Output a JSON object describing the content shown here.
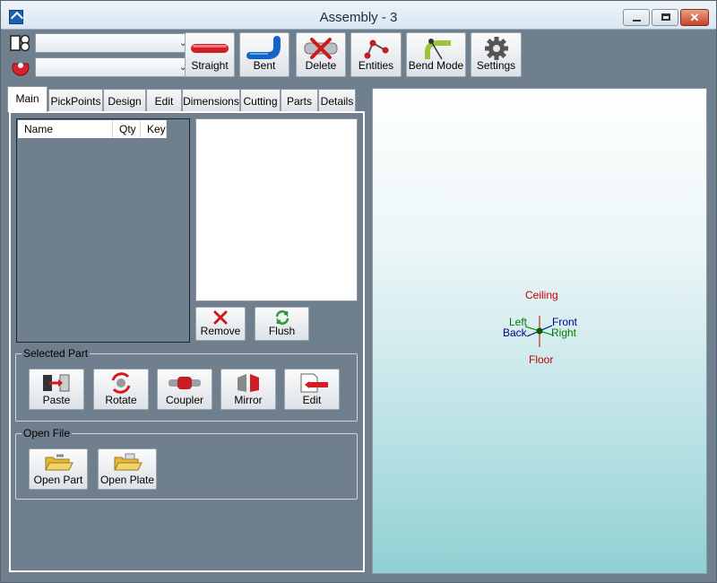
{
  "window": {
    "title": "Assembly - 3",
    "close_glyph": "✕"
  },
  "toolbar": {
    "combo_top_value": "",
    "combo_bottom_value": "",
    "buttons": [
      {
        "label": "Straight",
        "icon": "straight-pipe-icon"
      },
      {
        "label": "Bent",
        "icon": "bent-pipe-icon"
      },
      {
        "label": "Delete",
        "icon": "delete-icon"
      },
      {
        "label": "Entities",
        "icon": "entities-icon"
      },
      {
        "label": "Bend Mode",
        "icon": "bend-mode-icon"
      },
      {
        "label": "Settings",
        "icon": "gear-icon"
      }
    ]
  },
  "tabs": [
    "Main",
    "PickPoints",
    "Design",
    "Edit",
    "Dimensions",
    "Cutting",
    "Parts",
    "Details"
  ],
  "active_tab": "Main",
  "parts_list": {
    "columns": [
      "Name",
      "Qty",
      "Key"
    ],
    "rows": []
  },
  "list_actions": {
    "remove": "Remove",
    "flush": "Flush"
  },
  "selected_part": {
    "title": "Selected Part",
    "buttons": [
      "Paste",
      "Rotate",
      "Coupler",
      "Mirror",
      "Edit"
    ]
  },
  "open_file": {
    "title": "Open File",
    "buttons": [
      "Open Part",
      "Open Plate"
    ]
  },
  "viewport": {
    "orientation": {
      "ceiling": "Ceiling",
      "floor": "Floor",
      "left": "Left",
      "right": "Right",
      "front": "Front",
      "back": "Back"
    },
    "colors": {
      "vertical": "#c40000",
      "left_right": "#007a00",
      "front_back": "#00008b"
    }
  }
}
